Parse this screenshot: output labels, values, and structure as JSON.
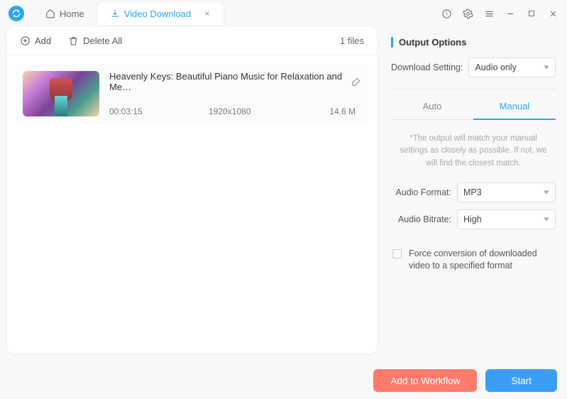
{
  "tabs": {
    "home": "Home",
    "video_download": "Video Download"
  },
  "toolbar": {
    "add": "Add",
    "delete_all": "Delete All",
    "files_count": "1 files"
  },
  "file": {
    "title": "Heavenly Keys: Beautiful Piano Music for Relaxation and Me…",
    "duration": "00:03:15",
    "resolution": "1920x1080",
    "size": "14.6 M"
  },
  "output": {
    "section_title": "Output Options",
    "download_setting_label": "Download Setting:",
    "download_setting_value": "Audio only",
    "tab_auto": "Auto",
    "tab_manual": "Manual",
    "hint": "*The output will match your manual settings as closely as possible. If not, we will find the closest match.",
    "audio_format_label": "Audio Format:",
    "audio_format_value": "MP3",
    "audio_bitrate_label": "Audio Bitrate:",
    "audio_bitrate_value": "High",
    "checkbox_label": "Force conversion of downloaded video to a specified format"
  },
  "footer": {
    "add_to_workflow": "Add to Workflow",
    "start": "Start"
  }
}
